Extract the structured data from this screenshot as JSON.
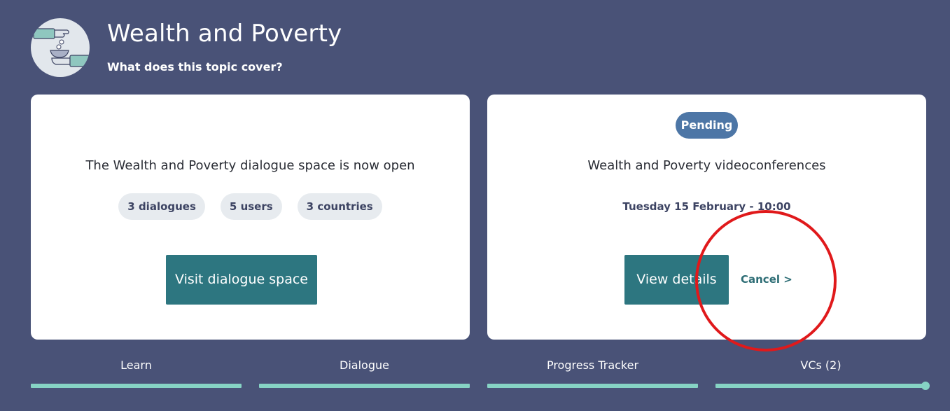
{
  "header": {
    "title": "Wealth and Poverty",
    "subtitle_link": "What does this topic cover?",
    "avatar_icon": "hands-bowl-icon"
  },
  "dialogue_card": {
    "message": "The Wealth and Poverty dialogue space is now open",
    "stats": [
      "3 dialogues",
      "5 users",
      "3 countries"
    ],
    "button_label": "Visit dialogue space"
  },
  "vc_card": {
    "status": "Pending",
    "title": "Wealth and Poverty videoconferences",
    "datetime": "Tuesday 15 February - 10:00",
    "details_label": "View details",
    "cancel_label": "Cancel >"
  },
  "tabs": [
    {
      "label": "Learn"
    },
    {
      "label": "Dialogue"
    },
    {
      "label": "Progress Tracker"
    },
    {
      "label": "VCs (2)"
    }
  ],
  "colors": {
    "background": "#495277",
    "card": "#ffffff",
    "button": "#2d7680",
    "badge": "#4d76a6",
    "tab_bar": "#86d3c4",
    "annotation": "#e0191b"
  }
}
